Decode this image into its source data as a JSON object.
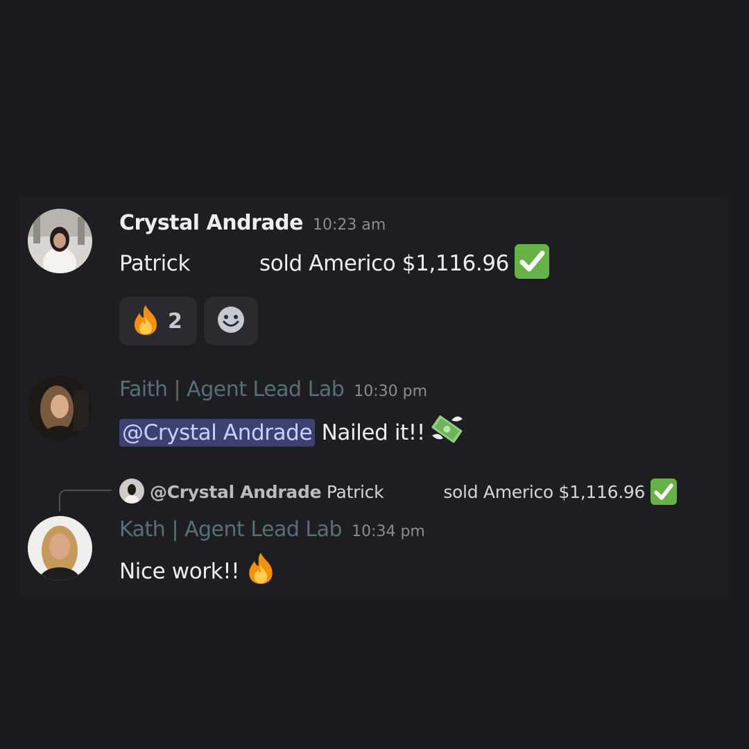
{
  "messages": [
    {
      "author": "Crystal Andrade",
      "time": "10:23 am",
      "text_before": "Patrick",
      "text_after": "sold Americo $1,116.96",
      "emoji": "white-check-mark",
      "reactions": [
        {
          "emoji": "fire",
          "count": "2"
        },
        {
          "emoji": "add-reaction-smiley",
          "count": ""
        }
      ]
    },
    {
      "author": "Faith | Agent Lead Lab",
      "time": "10:30 pm",
      "mention": "@Crystal Andrade",
      "text": "Nailed it!!",
      "emoji": "money-with-wings"
    },
    {
      "author": "Kath | Agent Lead Lab",
      "time": "10:34 pm",
      "reply": {
        "mention": "@Crystal Andrade",
        "text_before": "Patrick",
        "text_after": "sold Americo $1,116.96",
        "emoji": "white-check-mark"
      },
      "text": "Nice work!!",
      "emoji": "fire"
    }
  ],
  "colors": {
    "background": "#1b1a1f",
    "panel": "#1e1d22",
    "mention_bg": "#3c4270",
    "mention_text": "#c9d1ff",
    "role_name": "#586f78",
    "check_green": "#65b345"
  }
}
